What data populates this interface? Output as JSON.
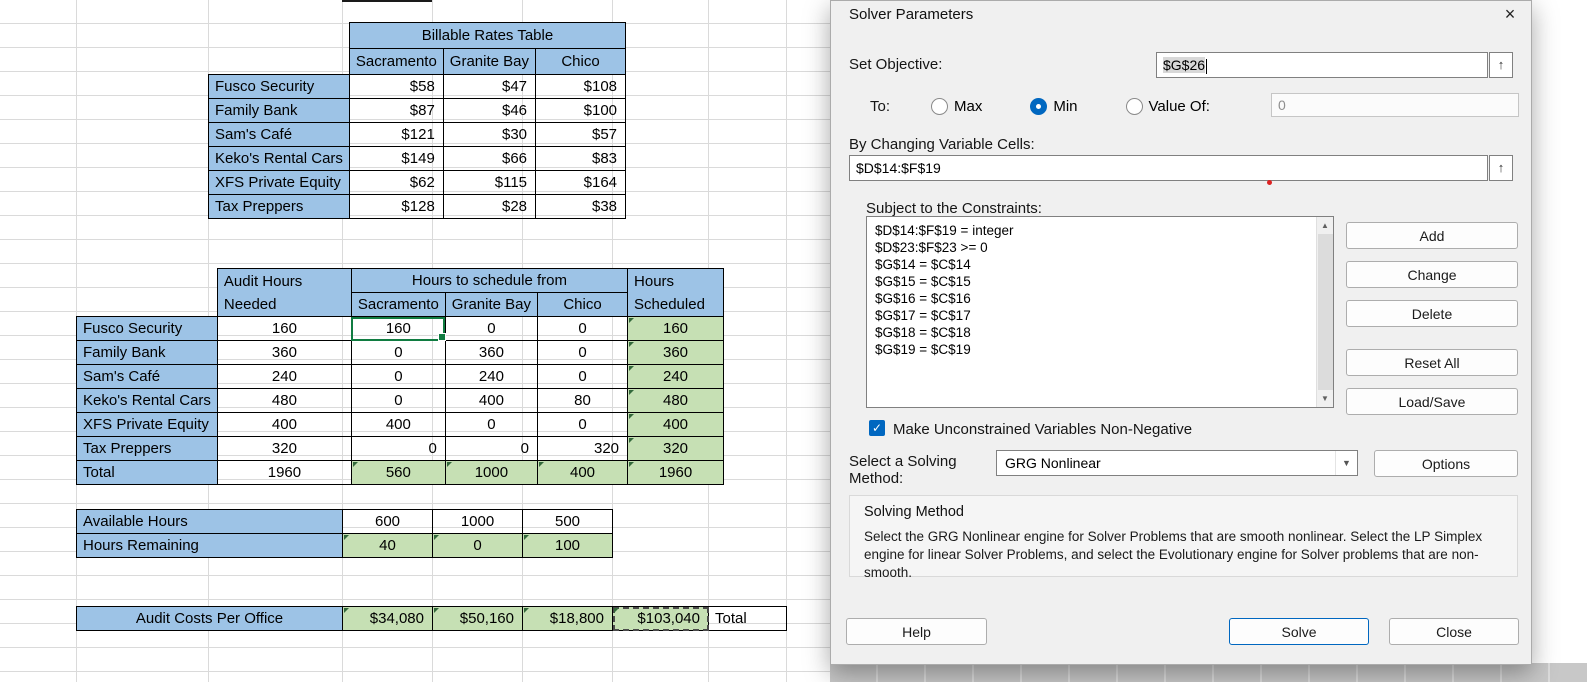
{
  "spreadsheet": {
    "rates_table": {
      "title": "Billable Rates Table",
      "offices": [
        "Sacramento",
        "Granite Bay",
        "Chico"
      ],
      "rows": [
        {
          "label": "Fusco Security",
          "values": [
            "$58",
            "$47",
            "$108"
          ]
        },
        {
          "label": "Family Bank",
          "values": [
            "$87",
            "$46",
            "$100"
          ]
        },
        {
          "label": "Sam's Café",
          "values": [
            "$121",
            "$30",
            "$57"
          ]
        },
        {
          "label": "Keko's Rental Cars",
          "values": [
            "$149",
            "$66",
            "$83"
          ]
        },
        {
          "label": "XFS Private Equity",
          "values": [
            "$62",
            "$115",
            "$164"
          ]
        },
        {
          "label": "Tax Preppers",
          "values": [
            "$128",
            "$28",
            "$38"
          ]
        }
      ]
    },
    "schedule_table": {
      "needed_header": [
        "Audit Hours",
        "Needed"
      ],
      "span_header": "Hours to schedule from",
      "offices": [
        "Sacramento",
        "Granite Bay",
        "Chico"
      ],
      "scheduled_header": [
        "Hours",
        "Scheduled"
      ],
      "rows": [
        {
          "label": "Fusco Security",
          "needed": "160",
          "alloc": [
            "160",
            "0",
            "0"
          ],
          "scheduled": "160"
        },
        {
          "label": "Family Bank",
          "needed": "360",
          "alloc": [
            "0",
            "360",
            "0"
          ],
          "scheduled": "360"
        },
        {
          "label": "Sam's Café",
          "needed": "240",
          "alloc": [
            "0",
            "240",
            "0"
          ],
          "scheduled": "240"
        },
        {
          "label": "Keko's Rental Cars",
          "needed": "480",
          "alloc": [
            "0",
            "400",
            "80"
          ],
          "scheduled": "480"
        },
        {
          "label": "XFS Private Equity",
          "needed": "400",
          "alloc": [
            "400",
            "0",
            "0"
          ],
          "scheduled": "400"
        },
        {
          "label": "Tax Preppers",
          "needed": "320",
          "alloc": [
            "0",
            "0",
            "320"
          ],
          "scheduled": "320"
        }
      ],
      "total_row": {
        "label": "Total",
        "needed": "1960",
        "alloc": [
          "560",
          "1000",
          "400"
        ],
        "scheduled": "1960"
      }
    },
    "capacity_table": {
      "available": {
        "label": "Available Hours",
        "values": [
          "600",
          "1000",
          "500"
        ]
      },
      "remaining": {
        "label": "Hours Remaining",
        "values": [
          "40",
          "0",
          "100"
        ]
      }
    },
    "costs_table": {
      "label": "Audit Costs Per Office",
      "values": [
        "$34,080",
        "$50,160",
        "$18,800"
      ],
      "grand_total": "$103,040",
      "total_label": "Total"
    }
  },
  "dialog": {
    "title": "Solver Parameters",
    "set_objective_label": "Set Objective:",
    "objective_value": "$G$26",
    "to_label": "To:",
    "max_label": "Max",
    "min_label": "Min",
    "value_of_label": "Value Of:",
    "value_of_value": "0",
    "by_changing_label": "By Changing Variable Cells:",
    "variable_cells_value": "$D$14:$F$19",
    "constraints_label": "Subject to the Constraints:",
    "constraints": [
      "$D$14:$F$19 = integer",
      "$D$23:$F$23 >= 0",
      "$G$14 = $C$14",
      "$G$15 = $C$15",
      "$G$16 = $C$16",
      "$G$17 = $C$17",
      "$G$18 = $C$18",
      "$G$19 = $C$19"
    ],
    "buttons": {
      "add": "Add",
      "change": "Change",
      "delete": "Delete",
      "reset_all": "Reset All",
      "load_save": "Load/Save",
      "options": "Options",
      "help": "Help",
      "solve": "Solve",
      "close": "Close"
    },
    "non_negative_label": "Make Unconstrained Variables Non-Negative",
    "solving_method_label": [
      "Select a Solving",
      "Method:"
    ],
    "solving_method_value": "GRG Nonlinear",
    "solving_method_title": "Solving Method",
    "solving_method_description": "Select the GRG Nonlinear engine for Solver Problems that are smooth nonlinear. Select the LP Simplex engine for linear Solver Problems, and select the Evolutionary engine for Solver problems that are non-smooth."
  },
  "icons": {
    "close": "×",
    "ref_picker": "↑",
    "dropdown": "▼",
    "scroll_up": "▲",
    "scroll_down": "▼",
    "check": "✓"
  },
  "colors": {
    "header_blue": "#9DC3E6",
    "formula_green": "#C6E0B4",
    "selection_green": "#107C41",
    "accent_blue": "#0067C0"
  }
}
